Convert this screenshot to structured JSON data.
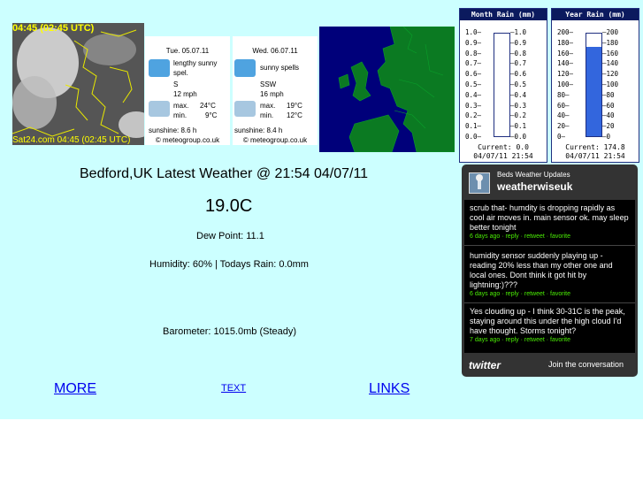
{
  "satellite": {
    "title": "04:45 (02:45 UTC)",
    "footer": "Sat24.com 04:45 (02:45 UTC)"
  },
  "forecasts": [
    {
      "date": "Tue. 05.07.11",
      "condition_line1": "lengthy sunny",
      "condition_line2": "spel.",
      "wind_dir": "S",
      "wind_speed": "12 mph",
      "max_label": "max.",
      "max": "24°C",
      "min_label": "min.",
      "min": "9°C",
      "sunshine": "sunshine: 8.6 h",
      "credit": "© meteogroup.co.uk"
    },
    {
      "date": "Wed. 06.07.11",
      "condition_line1": "sunny spells",
      "condition_line2": "",
      "wind_dir": "SSW",
      "wind_speed": "16 mph",
      "max_label": "max.",
      "max": "19°C",
      "min_label": "min.",
      "min": "12°C",
      "sunshine": "sunshine: 8.4 h",
      "credit": "© meteogroup.co.uk"
    }
  ],
  "gauges": [
    {
      "title": "Month Rain (mm)",
      "ticks": [
        "1.0",
        "0.9",
        "0.8",
        "0.7",
        "0.6",
        "0.5",
        "0.4",
        "0.3",
        "0.2",
        "0.1",
        "0.0"
      ],
      "current": "Current: 0.0",
      "timestamp": "04/07/11 21:54",
      "fill_fraction": 0.0,
      "fill_color": "#3366dd"
    },
    {
      "title": "Year Rain (mm)",
      "ticks": [
        "200",
        "180",
        "160",
        "140",
        "120",
        "100",
        "80",
        "60",
        "40",
        "20",
        "0"
      ],
      "current": "Current: 174.8",
      "timestamp": "04/07/11 21:54",
      "fill_fraction": 0.874,
      "fill_color": "#3366dd"
    }
  ],
  "weather": {
    "headline": "Bedford,UK Latest Weather @ 21:54 04/07/11",
    "temperature": "19.0C",
    "dew_point": "Dew Point: 11.1",
    "humidity_rain": "Humidity: 60% | Todays Rain: 0.0mm",
    "barometer": "Barometer: 1015.0mb (Steady)"
  },
  "nav": {
    "more": "MORE",
    "text": "TEXT",
    "links": "LINKS"
  },
  "twitter": {
    "subtitle": "Beds Weather Updates",
    "username": "weatherwiseuk",
    "tweets": [
      {
        "text": "scrub that- humdity is dropping rapidly as cool air moves in. main sensor ok. may sleep better tonight",
        "meta": "6 days ago · reply · retweet · favorite"
      },
      {
        "text": "humidity sensor suddenly playing up - reading 20% less than my other one and local ones. Dont think it got hit by lightning:)???",
        "meta": "6 days ago · reply · retweet · favorite"
      },
      {
        "text": "Yes clouding up - I think 30-31C is the peak, staying around this under the high cloud I'd have thought. Storms tonight?",
        "meta": "7 days ago · reply · retweet · favorite"
      }
    ],
    "logo": "twitter",
    "join": "Join the conversation"
  },
  "colors": {
    "page_background": "#ccffff",
    "link": "#0000ee",
    "widget_background": "#333333",
    "tweet_meta": "#4aed05"
  }
}
